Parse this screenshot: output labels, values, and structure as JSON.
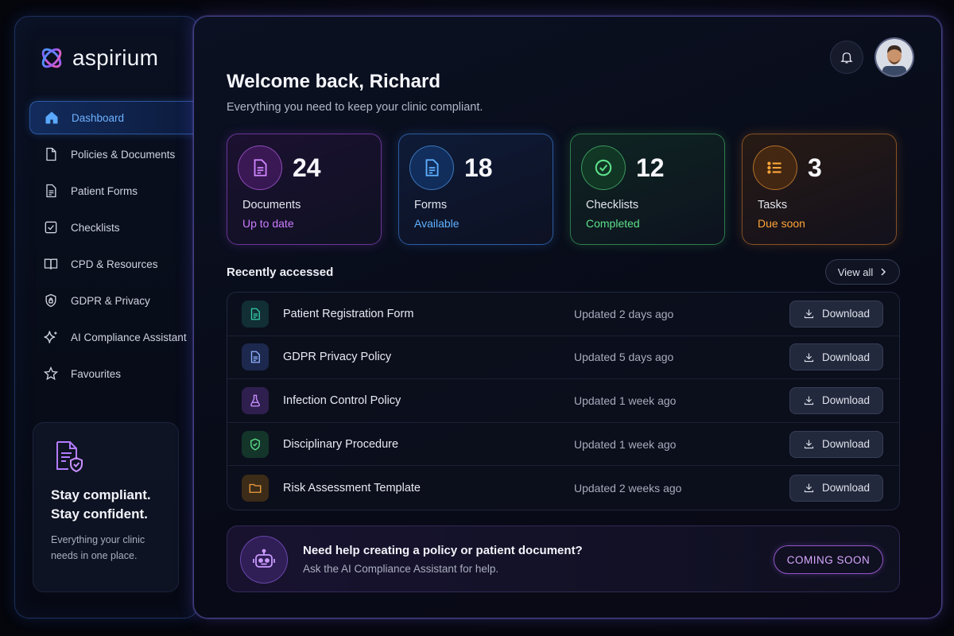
{
  "brand": {
    "name": "aspirium"
  },
  "sidebar": {
    "items": [
      {
        "label": "Dashboard",
        "icon": "home-icon",
        "active": true
      },
      {
        "label": "Policies & Documents",
        "icon": "document-icon"
      },
      {
        "label": "Patient Forms",
        "icon": "form-icon"
      },
      {
        "label": "Checklists",
        "icon": "checkbox-icon"
      },
      {
        "label": "CPD & Resources",
        "icon": "book-icon"
      },
      {
        "label": "GDPR & Privacy",
        "icon": "lock-shield-icon"
      },
      {
        "label": "AI Compliance Assistant",
        "icon": "sparkle-icon"
      },
      {
        "label": "Favourites",
        "icon": "star-icon"
      }
    ],
    "promo": {
      "title_line1": "Stay compliant.",
      "title_line2": "Stay confident.",
      "text_line1": "Everything your clinic",
      "text_line2": "needs in one place."
    }
  },
  "header": {
    "welcome": "Welcome back, Richard",
    "subtitle": "Everything you need to keep your clinic compliant."
  },
  "stats": [
    {
      "number": "24",
      "label": "Documents",
      "sub": "Up to date",
      "color": "#cc7dff",
      "icon": "document-icon"
    },
    {
      "number": "18",
      "label": "Forms",
      "sub": "Available",
      "color": "#5fb0ff",
      "icon": "form-icon"
    },
    {
      "number": "12",
      "label": "Checklists",
      "sub": "Completed",
      "color": "#5de08a",
      "icon": "check-circle-icon"
    },
    {
      "number": "3",
      "label": "Tasks",
      "sub": "Due soon",
      "color": "#ffa53a",
      "icon": "list-icon"
    }
  ],
  "recent": {
    "title": "Recently accessed",
    "view_all": "View all",
    "download_label": "Download",
    "rows": [
      {
        "name": "Patient Registration Form",
        "updated": "Updated 2 days ago",
        "icon": "form-icon",
        "color": "#35c9a8"
      },
      {
        "name": "GDPR Privacy Policy",
        "updated": "Updated 5 days ago",
        "icon": "document-icon",
        "color": "#6f9cff"
      },
      {
        "name": "Infection Control Policy",
        "updated": "Updated 1 week ago",
        "icon": "flask-icon",
        "color": "#c07bff"
      },
      {
        "name": "Disciplinary Procedure",
        "updated": "Updated 1 week ago",
        "icon": "shield-icon",
        "color": "#5de08a"
      },
      {
        "name": "Risk Assessment Template",
        "updated": "Updated 2 weeks ago",
        "icon": "folder-icon",
        "color": "#f0a040"
      }
    ]
  },
  "ai_card": {
    "title": "Need help creating a policy or patient document?",
    "subtitle": "Ask the AI Compliance Assistant for help.",
    "button": "COMING SOON",
    "icon": "robot-icon"
  }
}
